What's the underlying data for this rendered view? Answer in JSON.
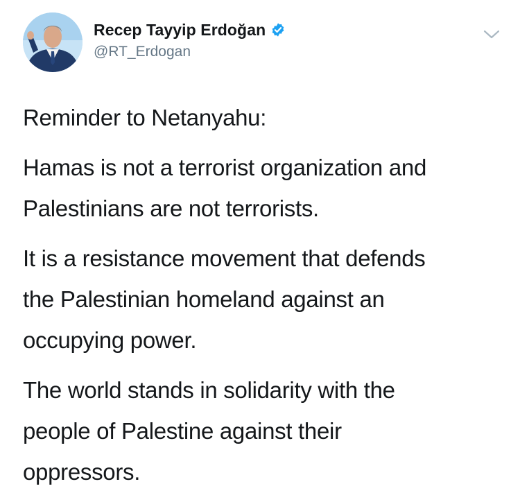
{
  "author": {
    "display_name": "Recep Tayyip Erdoğan",
    "handle": "@RT_Erdogan",
    "verified": true,
    "avatar_icon": "profile-photo",
    "verified_icon": "verified-badge-icon",
    "menu_icon": "chevron-down-icon"
  },
  "tweet": {
    "paragraphs": [
      "Reminder to Netanyahu:",
      "Hamas is not a terrorist organization and\nPalestinians are not terrorists.",
      "It is a resistance movement that defends\nthe Palestinian homeland against an\noccupying power.",
      "The world stands in solidarity with the\npeople of Palestine against their\noppressors."
    ]
  },
  "colors": {
    "text": "#14171a",
    "secondary_text": "#657786",
    "verified_blue": "#1da1f2",
    "chevron": "#aab8c2"
  }
}
